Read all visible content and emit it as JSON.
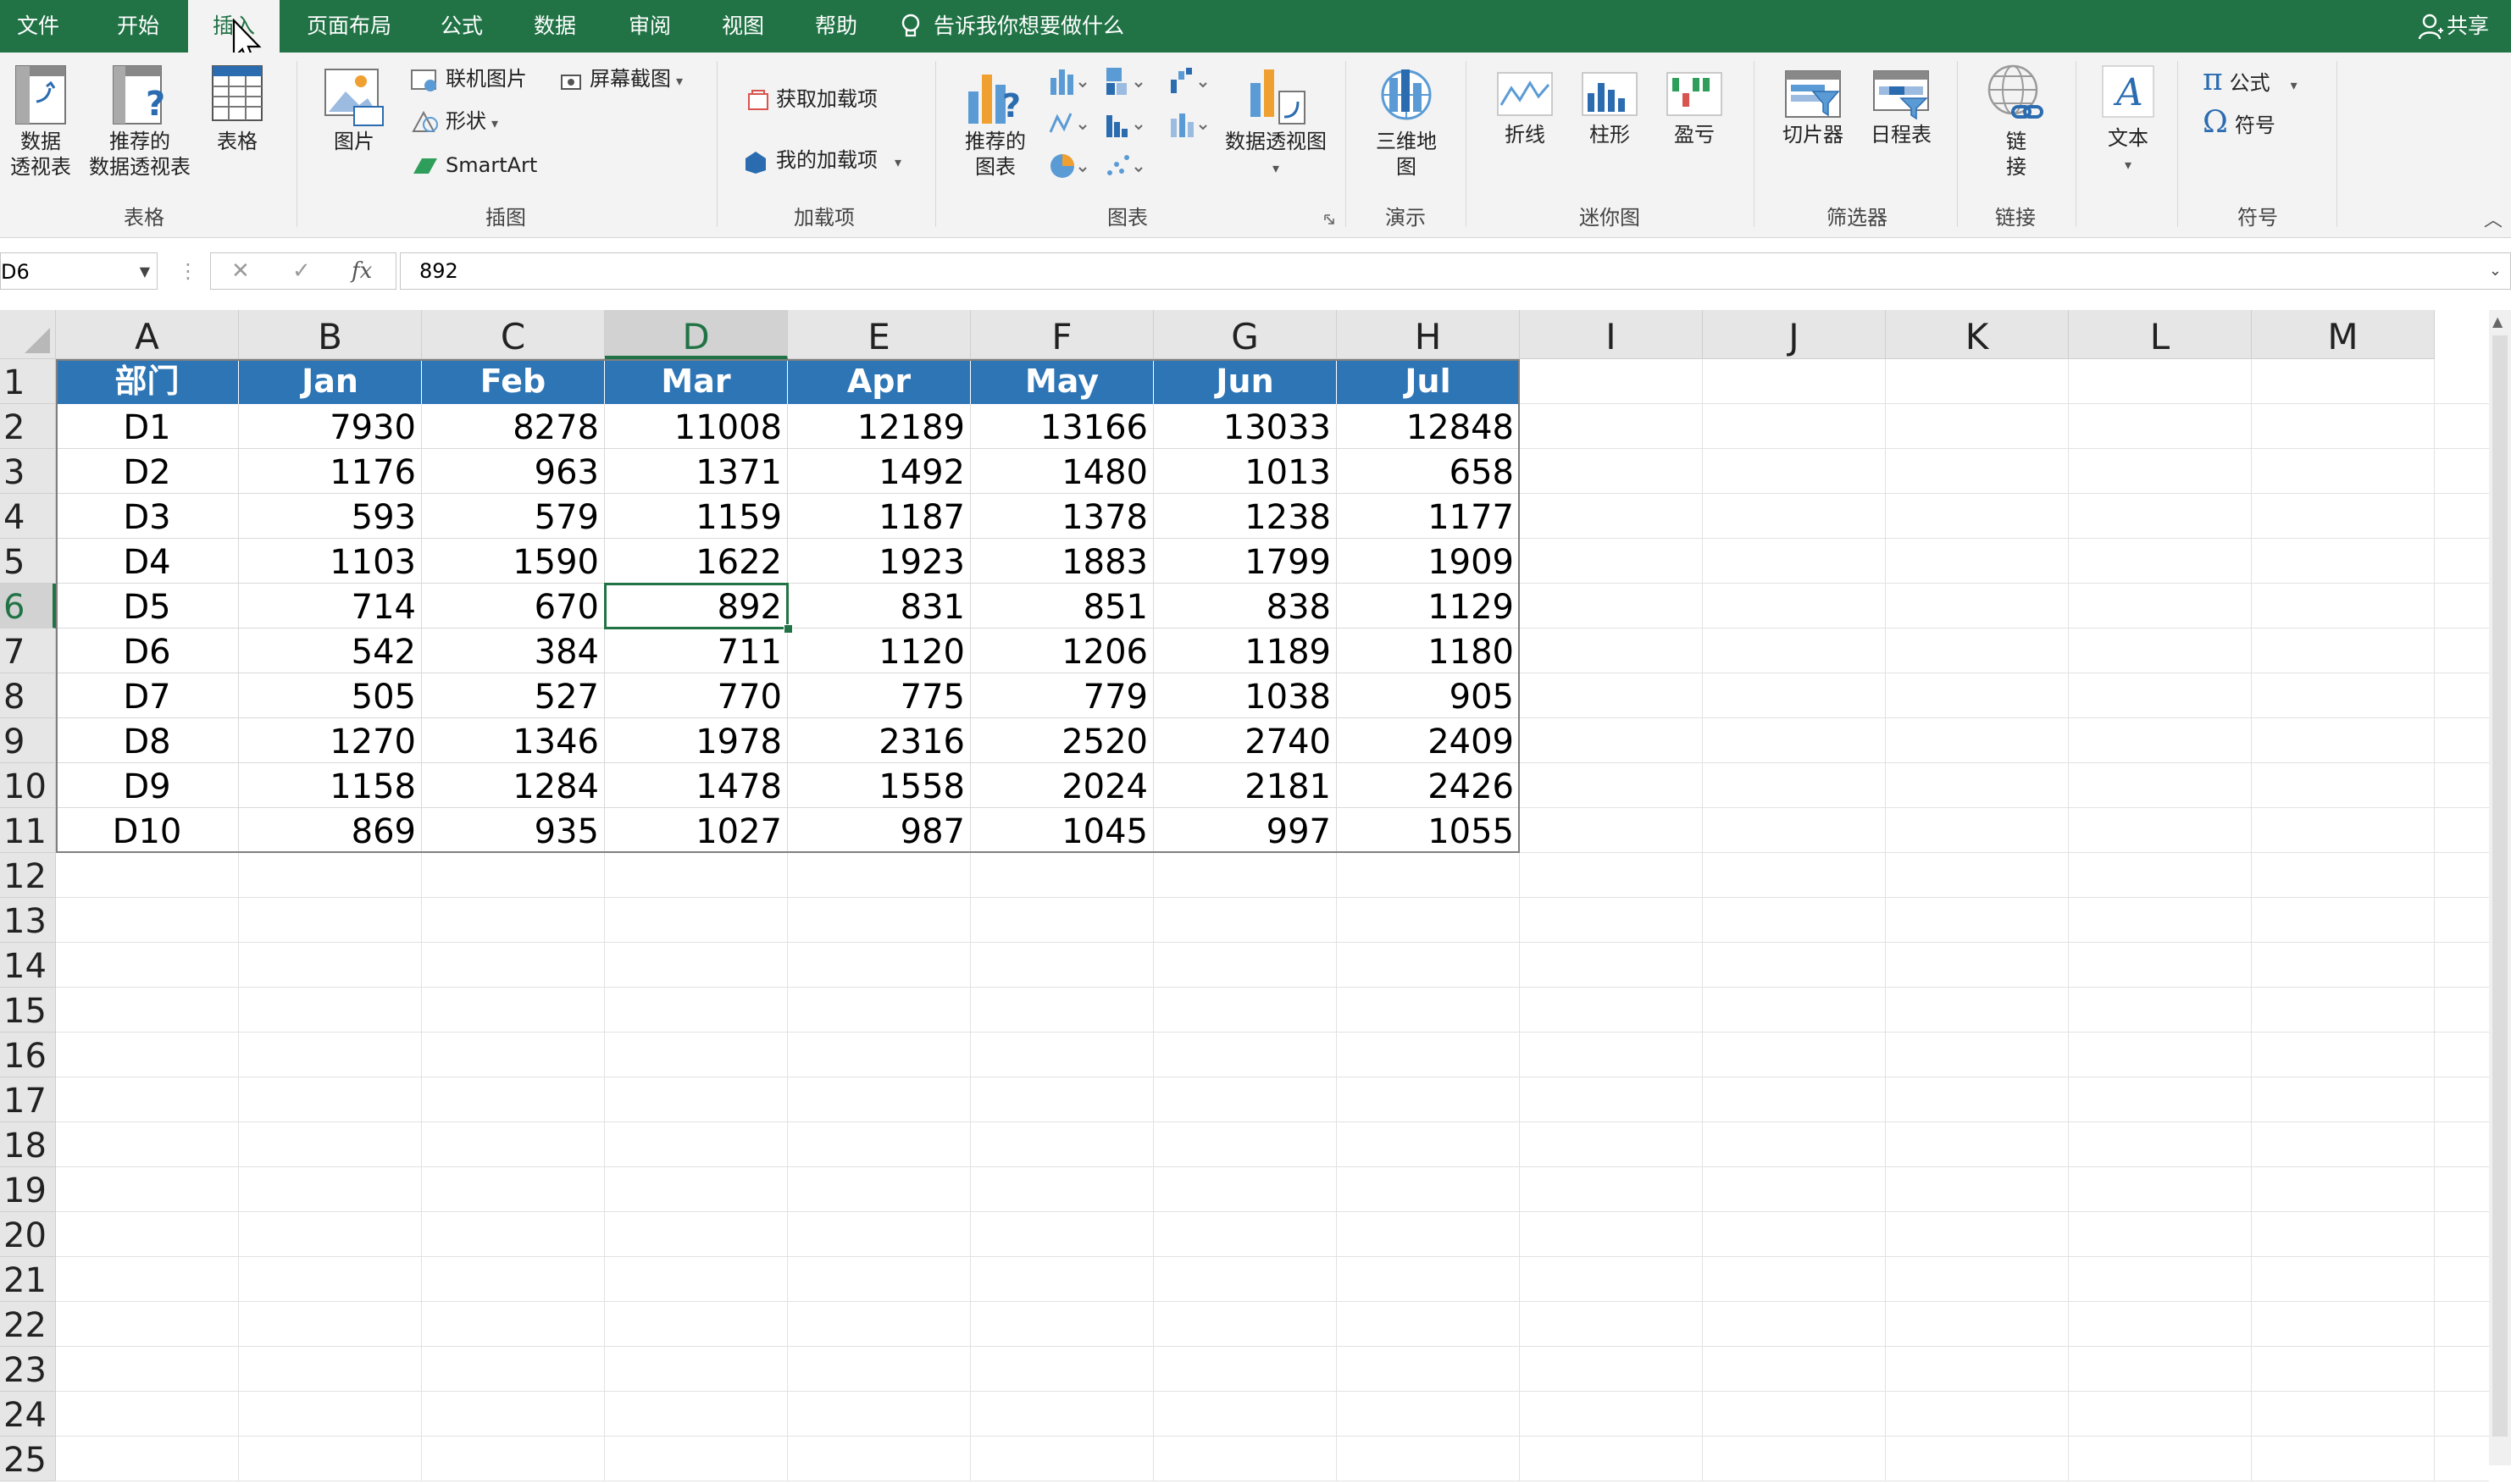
{
  "menu": {
    "tabs": [
      "文件",
      "开始",
      "插入",
      "页面布局",
      "公式",
      "数据",
      "审阅",
      "视图",
      "帮助"
    ],
    "active_tab": "插入",
    "tell_me": "告诉我你想要做什么",
    "share": "共享"
  },
  "ribbon": {
    "groups": {
      "tables": "表格",
      "illustrations": "插图",
      "addins": "加载项",
      "charts": "图表",
      "tours": "演示",
      "sparklines": "迷你图",
      "filters": "筛选器",
      "links": "链接",
      "symbols": "符号"
    },
    "pivot_table": [
      "数据",
      "透视表"
    ],
    "recommended_pivot": [
      "推荐的",
      "数据透视表"
    ],
    "table": "表格",
    "pictures": "图片",
    "online_pictures": "联机图片",
    "shapes": "形状",
    "smartart": "SmartArt",
    "screenshot": "屏幕截图",
    "get_addins": "获取加载项",
    "my_addins": "我的加载项",
    "recommended_charts": [
      "推荐的",
      "图表"
    ],
    "pivot_chart": "数据透视图",
    "map3d": [
      "三维地",
      "图"
    ],
    "spark_line": "折线",
    "spark_column": "柱形",
    "spark_winloss": "盈亏",
    "slicer": "切片器",
    "timeline": "日程表",
    "link": [
      "链",
      "接"
    ],
    "text": "文本",
    "equation": "公式",
    "symbol": "符号"
  },
  "formula_bar": {
    "name_box": "D6",
    "cancel": "✕",
    "enter": "✓",
    "fx": "fx",
    "value": "892"
  },
  "sheet": {
    "columns": [
      "A",
      "B",
      "C",
      "D",
      "E",
      "F",
      "G",
      "H",
      "I",
      "J",
      "K",
      "L",
      "M"
    ],
    "rows": [
      "1",
      "2",
      "3",
      "4",
      "5",
      "6",
      "7",
      "8",
      "9",
      "10",
      "11",
      "12",
      "13",
      "14",
      "15",
      "16",
      "17",
      "18",
      "19",
      "20",
      "21",
      "22",
      "23",
      "24",
      "25"
    ],
    "selected_cell": "D6",
    "header_row": [
      "部门",
      "Jan",
      "Feb",
      "Mar",
      "Apr",
      "May",
      "Jun",
      "Jul"
    ],
    "data": [
      [
        "D1",
        "7930",
        "8278",
        "11008",
        "12189",
        "13166",
        "13033",
        "12848"
      ],
      [
        "D2",
        "1176",
        "963",
        "1371",
        "1492",
        "1480",
        "1013",
        "658"
      ],
      [
        "D3",
        "593",
        "579",
        "1159",
        "1187",
        "1378",
        "1238",
        "1177"
      ],
      [
        "D4",
        "1103",
        "1590",
        "1622",
        "1923",
        "1883",
        "1799",
        "1909"
      ],
      [
        "D5",
        "714",
        "670",
        "892",
        "831",
        "851",
        "838",
        "1129"
      ],
      [
        "D6",
        "542",
        "384",
        "711",
        "1120",
        "1206",
        "1189",
        "1180"
      ],
      [
        "D7",
        "505",
        "527",
        "770",
        "775",
        "779",
        "1038",
        "905"
      ],
      [
        "D8",
        "1270",
        "1346",
        "1978",
        "2316",
        "2520",
        "2740",
        "2409"
      ],
      [
        "D9",
        "1158",
        "1284",
        "1478",
        "1558",
        "2024",
        "2181",
        "2426"
      ],
      [
        "D10",
        "869",
        "935",
        "1027",
        "987",
        "1045",
        "997",
        "1055"
      ]
    ]
  },
  "colors": {
    "excel_green": "#217346",
    "table_header_blue": "#2e75b6",
    "ribbon_bg": "#f3f3f3"
  }
}
